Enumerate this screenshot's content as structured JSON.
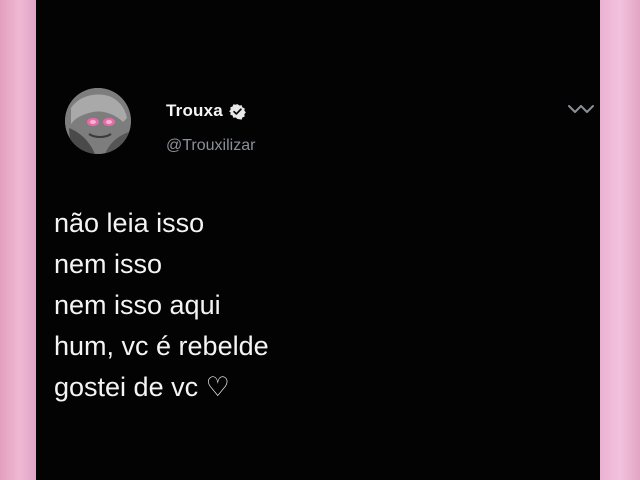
{
  "tweet": {
    "display_name": "Trouxa",
    "handle": "@Trouxilizar",
    "verified": true,
    "lines": [
      "não leia isso",
      "nem isso",
      "nem isso aqui",
      "hum, vc é rebelde",
      "gostei de vc ♡"
    ]
  },
  "icons": {
    "verified": "verified-badge-icon",
    "menu": "chevron-down-icon",
    "avatar": "avatar"
  },
  "colors": {
    "background": "#030303",
    "frame": "#e3a5c4",
    "text": "#f4f4f4",
    "handle": "#8b9097"
  }
}
